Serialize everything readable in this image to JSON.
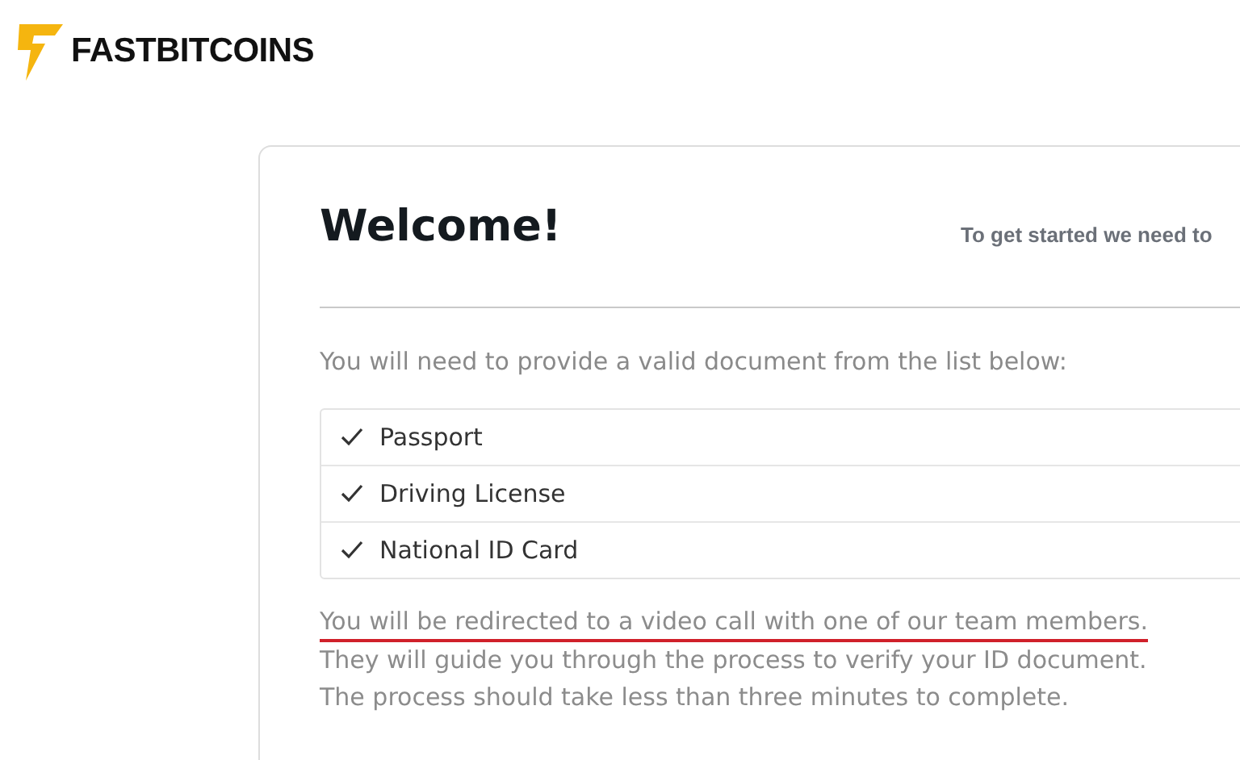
{
  "header": {
    "logo_text": "FASTBITCOINS"
  },
  "card": {
    "title": "Welcome!",
    "side_text": "To get started we need to",
    "intro": "You will need to provide a valid document from the list below:",
    "documents": [
      {
        "label": "Passport",
        "checked": true
      },
      {
        "label": "Driving License",
        "checked": true
      },
      {
        "label": "National ID Card",
        "checked": true
      }
    ],
    "notes": [
      {
        "text": "You will be redirected to a video call with one of our team members.",
        "underlined": true
      },
      {
        "text": "They will guide you through the process to verify your ID document.",
        "underlined": false
      },
      {
        "text": "The process should take less than three minutes to complete.",
        "underlined": false
      }
    ]
  }
}
